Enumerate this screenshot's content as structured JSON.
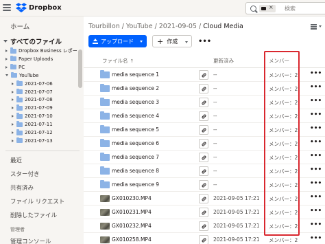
{
  "app": {
    "brand_name": "Dropbox",
    "accent_color": "#0061fe"
  },
  "search": {
    "placeholder": "検索",
    "chip_close": "×"
  },
  "sidebar": {
    "home": "ホーム",
    "all_files": "すべてのファイル",
    "tree": [
      {
        "label": "Dropbox Business レポー",
        "open": false
      },
      {
        "label": "Paper Uploads",
        "open": false
      },
      {
        "label": "PC",
        "open": false
      },
      {
        "label": "YouTube",
        "open": true
      },
      {
        "label": "2021-07-06",
        "open": false
      },
      {
        "label": "2021-07-07",
        "open": false
      },
      {
        "label": "2021-07-08",
        "open": false
      },
      {
        "label": "2021-07-09",
        "open": false
      },
      {
        "label": "2021-07-10",
        "open": false
      },
      {
        "label": "2021-07-11",
        "open": false
      },
      {
        "label": "2021-07-12",
        "open": false
      },
      {
        "label": "2021-07-13",
        "open": false
      }
    ],
    "nav": {
      "recent": "最近",
      "starred": "スター付き",
      "shared": "共有済み",
      "file_requests": "ファイル リクエスト",
      "deleted": "削除したファイル",
      "admin_heading": "管理者",
      "admin_console": "管理コンソール"
    }
  },
  "breadcrumb": {
    "items": [
      "Tourbillon",
      "YouTube",
      "2021-09-05"
    ],
    "separator": "/",
    "current": "Cloud Media"
  },
  "toolbar": {
    "upload_label": "アップロード",
    "create_label": "作成",
    "more_label": "•••"
  },
  "table": {
    "headers": {
      "name": "ファイル名",
      "sort_indicator": "↑",
      "modified": "更新済み",
      "members": "メンバー"
    },
    "rows": [
      {
        "type": "folder",
        "name": "media sequence 1",
        "modified": "--",
        "members": "メンバー：2"
      },
      {
        "type": "folder",
        "name": "media sequence 2",
        "modified": "--",
        "members": "メンバー：2"
      },
      {
        "type": "folder",
        "name": "media sequence 3",
        "modified": "--",
        "members": "メンバー：2"
      },
      {
        "type": "folder",
        "name": "media sequence 4",
        "modified": "--",
        "members": "メンバー：2"
      },
      {
        "type": "folder",
        "name": "media sequence 5",
        "modified": "--",
        "members": "メンバー：2"
      },
      {
        "type": "folder",
        "name": "media sequence 6",
        "modified": "--",
        "members": "メンバー：2"
      },
      {
        "type": "folder",
        "name": "media sequence 7",
        "modified": "--",
        "members": "メンバー：2"
      },
      {
        "type": "folder",
        "name": "media sequence 8",
        "modified": "--",
        "members": "メンバー：2"
      },
      {
        "type": "folder",
        "name": "media sequence 9",
        "modified": "--",
        "members": "メンバー：2"
      },
      {
        "type": "video",
        "name": "GX010230.MP4",
        "modified": "2021-09-05 17:21",
        "members": "メンバー：2"
      },
      {
        "type": "video",
        "name": "GX010231.MP4",
        "modified": "2021-09-05 17:21",
        "members": "メンバー：2"
      },
      {
        "type": "video",
        "name": "GX010232.MP4",
        "modified": "2021-09-05 17:21",
        "members": "メンバー：2"
      },
      {
        "type": "video",
        "name": "GX010258.MP4",
        "modified": "2021-09-05 17:21",
        "members": "メンバー：2"
      }
    ],
    "row_more": "•••"
  },
  "highlight_color": "#d9272e"
}
